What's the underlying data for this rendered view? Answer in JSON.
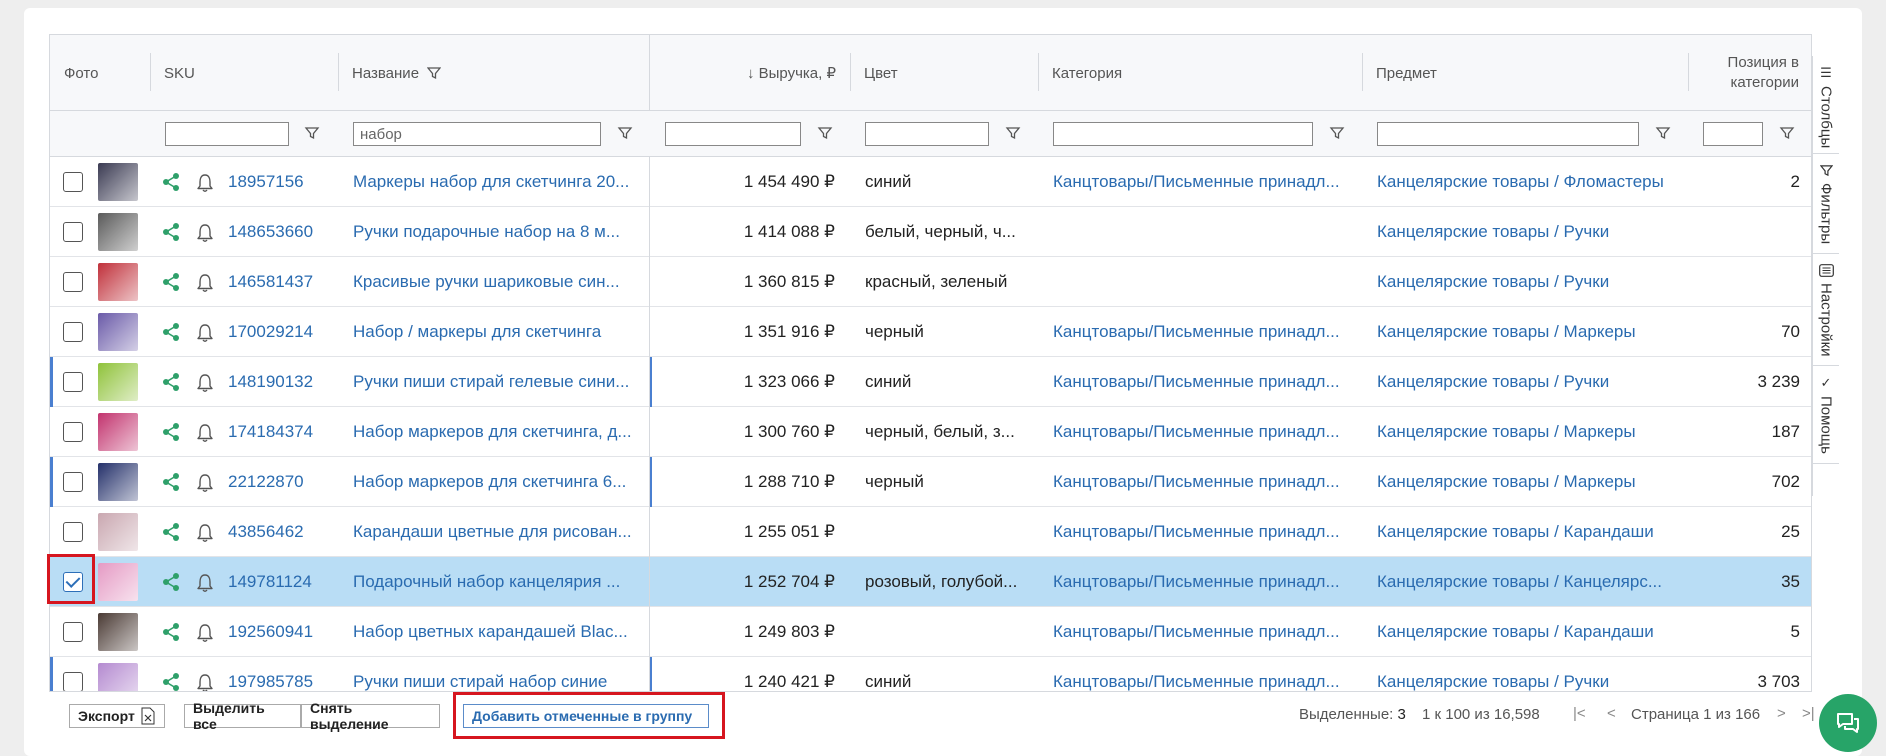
{
  "header": {
    "columns": {
      "photo": "Фото",
      "sku": "SKU",
      "name": "Название",
      "revenue": "↓ Выручка, ₽",
      "color": "Цвет",
      "category": "Категория",
      "subject": "Предмет",
      "position_line1": "Позиция в",
      "position_line2": "категории"
    }
  },
  "filters": {
    "sku": "",
    "name": "набор",
    "revenue": "",
    "color": "",
    "category": "",
    "subject": "",
    "position": ""
  },
  "rows": [
    {
      "sku": "18957156",
      "name": "Маркеры набор для скетчинга 20...",
      "revenue": "1 454 490 ₽",
      "color": "синий",
      "category": "Канцтовары/Письменные принадл...",
      "subject": "Канцелярские товары / Фломастеры",
      "position": "2",
      "photo_color": "#3a3a52"
    },
    {
      "sku": "148653660",
      "name": "Ручки подарочные набор на 8 м...",
      "revenue": "1 414 088 ₽",
      "color": "белый, черный, ч...",
      "category": "",
      "subject": "Канцелярские товары / Ручки",
      "position": "",
      "photo_color": "#5a5a5a"
    },
    {
      "sku": "146581437",
      "name": "Красивые ручки шариковые син...",
      "revenue": "1 360 815 ₽",
      "color": "красный, зеленый",
      "category": "",
      "subject": "Канцелярские товары / Ручки",
      "position": "",
      "photo_color": "#c0303a"
    },
    {
      "sku": "170029214",
      "name": "Набор / маркеры для скетчинга",
      "revenue": "1 351 916 ₽",
      "color": "черный",
      "category": "Канцтовары/Письменные принадл...",
      "subject": "Канцелярские товары / Маркеры",
      "position": "70",
      "photo_color": "#6a5aa8"
    },
    {
      "sku": "148190132",
      "name": "Ручки пиши стирай гелевые сини...",
      "revenue": "1 323 066 ₽",
      "color": "синий",
      "category": "Канцтовары/Письменные принадл...",
      "subject": "Канцелярские товары / Ручки",
      "position": "3 239",
      "photo_color": "#8fc23a"
    },
    {
      "sku": "174184374",
      "name": "Набор маркеров для скетчинга, д...",
      "revenue": "1 300 760 ₽",
      "color": "черный, белый, з...",
      "category": "Канцтовары/Письменные принадл...",
      "subject": "Канцелярские товары / Маркеры",
      "position": "187",
      "photo_color": "#c2336e"
    },
    {
      "sku": "22122870",
      "name": "Набор маркеров для скетчинга 6...",
      "revenue": "1 288 710 ₽",
      "color": "черный",
      "category": "Канцтовары/Письменные принадл...",
      "subject": "Канцелярские товары / Маркеры",
      "position": "702",
      "photo_color": "#24306a"
    },
    {
      "sku": "43856462",
      "name": "Карандаши цветные для рисован...",
      "revenue": "1 255 051 ₽",
      "color": "",
      "category": "Канцтовары/Письменные принадл...",
      "subject": "Канцелярские товары / Карандаши",
      "position": "25",
      "photo_color": "#c9a7b0"
    },
    {
      "sku": "149781124",
      "name": "Подарочный набор канцелярия ...",
      "revenue": "1 252 704 ₽",
      "color": "розовый, голубой...",
      "category": "Канцтовары/Письменные принадл...",
      "subject": "Канцелярские товары / Канцелярс...",
      "position": "35",
      "photo_color": "#e59ac4"
    },
    {
      "sku": "192560941",
      "name": "Набор цветных карандашей Blac...",
      "revenue": "1 249 803 ₽",
      "color": "",
      "category": "Канцтовары/Письменные принадл...",
      "subject": "Канцелярские товары / Карандаши",
      "position": "5",
      "photo_color": "#4a3a34"
    },
    {
      "sku": "197985785",
      "name": "Ручки пиши стирай набор синие",
      "revenue": "1 240 421 ₽",
      "color": "синий",
      "category": "Канцтовары/Письменные принадл...",
      "subject": "Канцелярские товары / Ручки",
      "position": "3 703",
      "photo_color": "#b48ad0"
    }
  ],
  "side_panel": {
    "columns": "Столбцы",
    "filters": "Фильтры",
    "settings": "Настройки",
    "help": "Помощь"
  },
  "footer": {
    "export": "Экспорт",
    "select_all": "Выделить все",
    "deselect": "Снять выделение",
    "add_to_group": "Добавить отмеченные в группу",
    "selected_label": "Выделенные:",
    "selected_count": "3",
    "range": "1 к 100 из 16,598",
    "page": "Страница 1 из 166"
  },
  "colors": {
    "link": "#2a6bb0",
    "selected_row": "#b9ddf5",
    "accent_green": "#27a468",
    "highlight_red": "#d6161f"
  }
}
